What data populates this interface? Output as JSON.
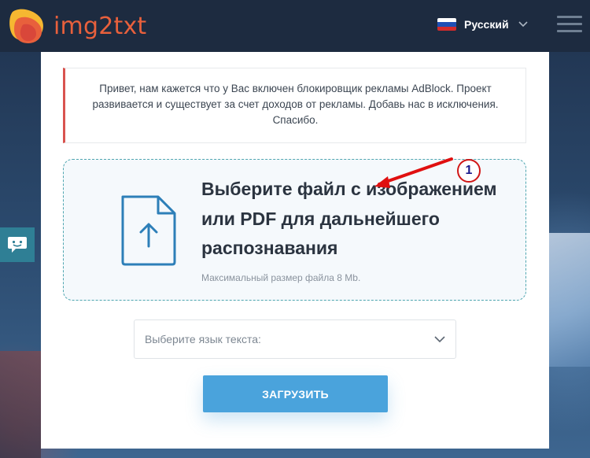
{
  "header": {
    "logo_text": "img2txt",
    "language_label": "Русский",
    "icons": {
      "logo": "img2txt-logo-icon",
      "flag": "russia-flag-icon",
      "chevron": "chevron-down-icon",
      "menu": "hamburger-menu-icon"
    }
  },
  "notice": {
    "text": "Привет, нам кажется что у Вас включен блокировщик рекламы AdBlock. Проект развивается и существует за счет доходов от рекламы. Добавь нас в исключения. Спасибо."
  },
  "dropzone": {
    "title": "Выберите файл с изображением или PDF для дальнейшего распознавания",
    "hint": "Максимальный размер файла 8 Mb.",
    "icon": "file-upload-icon"
  },
  "annotation": {
    "badge_number": "1"
  },
  "language_select": {
    "placeholder": "Выберите язык текста:",
    "icon": "chevron-down-icon"
  },
  "upload_button": {
    "label": "ЗАГРУЗИТЬ"
  },
  "chat_widget": {
    "icon": "chat-bubble-icon"
  },
  "colors": {
    "header_bg": "#1d2b40",
    "logo_text": "#e8603c",
    "notice_border": "#d9534f",
    "dropzone_border": "#4fa6b0",
    "upload_button": "#4aa3dc",
    "chat_widget": "#2f7f95",
    "annotation_red": "#d01616"
  }
}
